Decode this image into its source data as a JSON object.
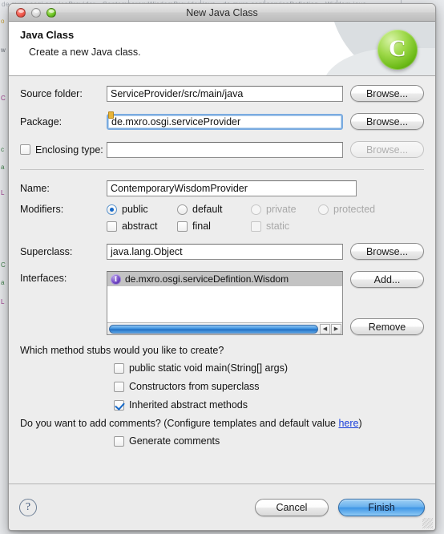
{
  "background": {
    "top_strip_text": "de.mxro.osgi.serviceProvider  •  ContemporaryWisdomProvider.java  •  de.mxro.osgi.serviceDefintion  •  Wisdom.java",
    "side_fragments": [
      "o",
      "w",
      "C",
      "c",
      "a",
      "L",
      "C",
      "a",
      "L"
    ]
  },
  "window": {
    "title": "New Java Class",
    "controls": {
      "close_label": "close",
      "minimize_label": "minimize",
      "zoom_label": "zoom"
    }
  },
  "header": {
    "title": "Java Class",
    "subtitle": "Create a new Java class.",
    "logo_glyph": "C",
    "logo_color": "#69b814"
  },
  "form": {
    "source_folder": {
      "label": "Source folder:",
      "value": "ServiceProvider/src/main/java",
      "button": "Browse..."
    },
    "package": {
      "label": "Package:",
      "value": "de.mxro.osgi.serviceProvider",
      "button": "Browse...",
      "focused": true,
      "marker": "content-assist-marker"
    },
    "enclosing_type": {
      "label": "Enclosing type:",
      "value": "",
      "button": "Browse...",
      "checked": false,
      "button_disabled": true
    },
    "name": {
      "label": "Name:",
      "value": "ContemporaryWisdomProvider"
    },
    "modifiers": {
      "label": "Modifiers:",
      "radios": [
        {
          "label": "public",
          "selected": true,
          "disabled": false
        },
        {
          "label": "default",
          "selected": false,
          "disabled": false
        },
        {
          "label": "private",
          "selected": false,
          "disabled": true
        },
        {
          "label": "protected",
          "selected": false,
          "disabled": true
        }
      ],
      "checks": [
        {
          "label": "abstract",
          "checked": false,
          "disabled": false
        },
        {
          "label": "final",
          "checked": false,
          "disabled": false
        },
        {
          "label": "static",
          "checked": false,
          "disabled": true
        }
      ]
    },
    "superclass": {
      "label": "Superclass:",
      "value": "java.lang.Object",
      "button": "Browse..."
    },
    "interfaces": {
      "label": "Interfaces:",
      "items": [
        {
          "icon": "interface-icon",
          "text": "de.mxro.osgi.serviceDefintion.Wisdom"
        }
      ],
      "add_button": "Add...",
      "remove_button": "Remove",
      "scroll_left_glyph": "◀",
      "scroll_right_glyph": "▶"
    }
  },
  "stubs": {
    "question": "Which method stubs would you like to create?",
    "options": [
      {
        "label": "public static void main(String[] args)",
        "checked": false
      },
      {
        "label": "Constructors from superclass",
        "checked": false
      },
      {
        "label": "Inherited abstract methods",
        "checked": true
      }
    ]
  },
  "comments": {
    "question_prefix": "Do you want to add comments? (Configure templates and default value ",
    "link": "here",
    "question_suffix": ")",
    "option": {
      "label": "Generate comments",
      "checked": false
    }
  },
  "footer": {
    "help_glyph": "?",
    "cancel_label": "Cancel",
    "finish_label": "Finish",
    "resize_grip": "resize-grip"
  }
}
